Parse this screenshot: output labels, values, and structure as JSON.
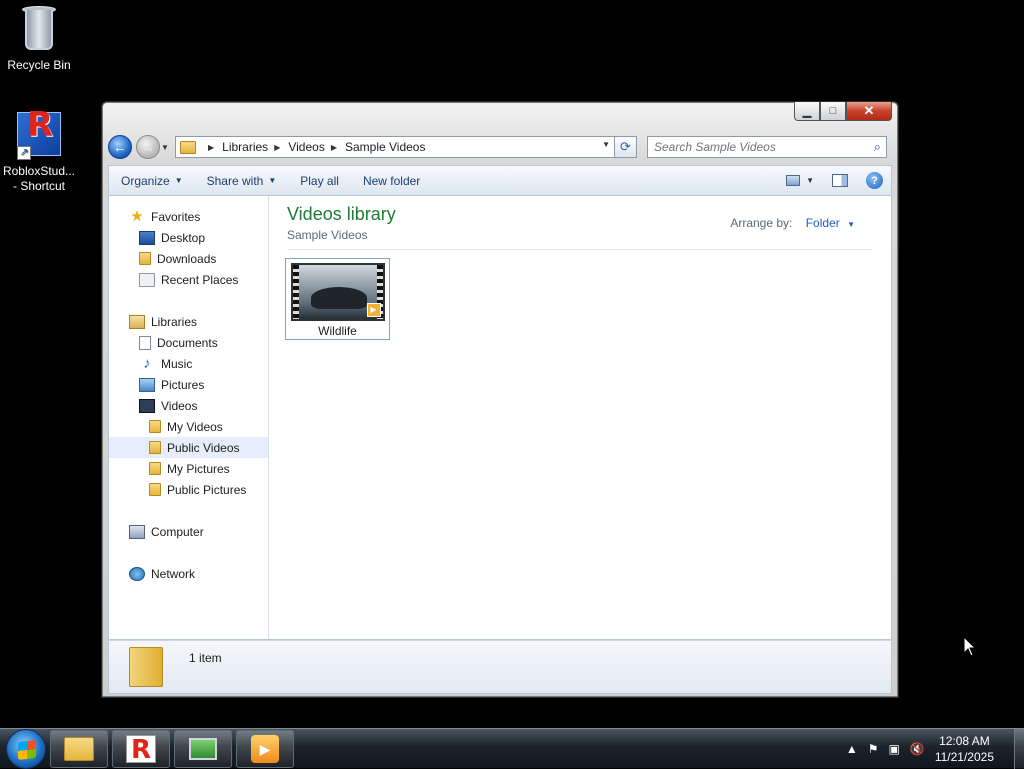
{
  "desktop": {
    "icons": [
      {
        "label": "Recycle Bin",
        "icon": "recycle-bin-icon"
      },
      {
        "label_line1": "RobloxStud...",
        "label_line2": "- Shortcut",
        "icon": "roblox-studio-icon"
      }
    ]
  },
  "window": {
    "caption": {
      "minimize": "▁",
      "maximize": "□",
      "close": "✕"
    },
    "address": {
      "crumbs": [
        "Libraries",
        "Videos",
        "Sample Videos"
      ]
    },
    "search": {
      "placeholder": "Search Sample Videos"
    },
    "toolbar": {
      "organize": "Organize",
      "share_with": "Share with",
      "play_all": "Play all",
      "new_folder": "New folder"
    },
    "nav": {
      "favorites": "Favorites",
      "desktop": "Desktop",
      "downloads": "Downloads",
      "recent_places": "Recent Places",
      "libraries": "Libraries",
      "documents": "Documents",
      "music": "Music",
      "pictures": "Pictures",
      "videos": "Videos",
      "my_videos": "My Videos",
      "public_videos": "Public Videos",
      "my_pictures": "My Pictures",
      "public_pictures": "Public Pictures",
      "computer": "Computer",
      "network": "Network",
      "selected": "Public Videos"
    },
    "main": {
      "title": "Videos library",
      "subtitle": "Sample Videos",
      "arrange_label": "Arrange by:",
      "arrange_value": "Folder",
      "files": [
        {
          "name": "Wildlife",
          "type": "video"
        }
      ]
    },
    "details": {
      "count": "1 item"
    }
  },
  "taskbar": {
    "apps": [
      "windows-explorer",
      "roblox",
      "system-monitor",
      "media-center"
    ],
    "clock": {
      "time": "12:08 AM",
      "date": "11/21/2025"
    }
  },
  "colors": {
    "library_title": "#1e7a34",
    "link": "#1e5ebc",
    "selection": "#e5eefa"
  }
}
